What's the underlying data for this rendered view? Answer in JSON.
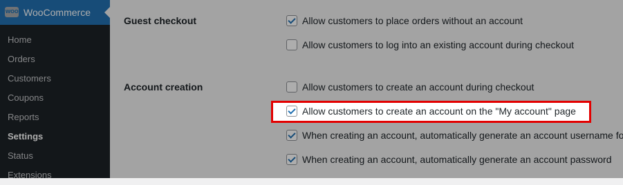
{
  "sidebar": {
    "brand": "WooCommerce",
    "logo_text": "WOO",
    "items": [
      {
        "label": "Home"
      },
      {
        "label": "Orders"
      },
      {
        "label": "Customers"
      },
      {
        "label": "Coupons"
      },
      {
        "label": "Reports"
      },
      {
        "label": "Settings",
        "active": true
      },
      {
        "label": "Status"
      },
      {
        "label": "Extensions"
      }
    ]
  },
  "settings": {
    "guest_checkout": {
      "label": "Guest checkout",
      "options": [
        {
          "text": "Allow customers to place orders without an account",
          "checked": true
        },
        {
          "text": "Allow customers to log into an existing account during checkout",
          "checked": false
        }
      ]
    },
    "account_creation": {
      "label": "Account creation",
      "options": [
        {
          "text": "Allow customers to create an account during checkout",
          "checked": false
        },
        {
          "text": "Allow customers to create an account on the \"My account\" page",
          "checked": true
        },
        {
          "text": "When creating an account, automatically generate an account username for",
          "checked": true
        },
        {
          "text": "When creating an account, automatically generate an account password",
          "checked": true
        }
      ]
    }
  },
  "colors": {
    "sidebar_bg": "#1d2327",
    "accent": "#2271b1",
    "highlight_border": "#e30000"
  }
}
